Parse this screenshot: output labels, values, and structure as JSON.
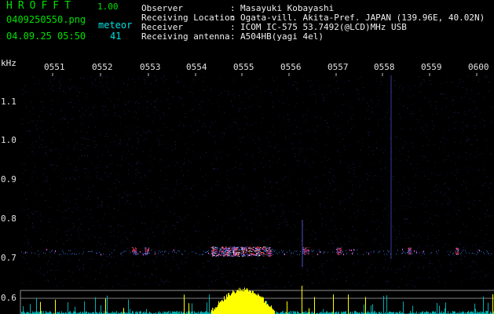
{
  "program": {
    "name": "HROFFT",
    "version": "1.00",
    "filename": "0409250550.png",
    "datetime": "04.09.25 05:50",
    "counter_label": "meteor",
    "counter_value": "41"
  },
  "station": {
    "labels": [
      "Observer",
      "Receiving Location",
      "Receiver",
      "Receiving antenna"
    ],
    "separator": ":",
    "values": [
      "Masayuki Kobayashi",
      "Ogata-vill. Akita-Pref. JAPAN (139.96E, 40.02N)",
      "ICOM IC-575 53.7492(@LCD)MHz USB",
      "A504HB(yagi 4el)"
    ]
  },
  "axis": {
    "unit": "kHz",
    "time_ticks": [
      "0551",
      "0552",
      "0553",
      "0554",
      "0555",
      "0556",
      "0557",
      "0558",
      "0559",
      "0600"
    ],
    "freq_ticks": [
      "1.1",
      "1.0",
      "0.9",
      "0.8",
      "0.7",
      "0.6"
    ]
  },
  "colors": {
    "background": "#000000",
    "label_green": "#00e000",
    "label_white": "#f0f0f0",
    "counter_cyan": "#00e0e0",
    "noise": "#2a2a7a",
    "signal_hot": "#ff3030",
    "signal_warm": "#ff66ff",
    "signal_blue": "#4080ff",
    "meter_yellow": "#ffff00",
    "meter_cyan": "#00c0c0"
  }
}
